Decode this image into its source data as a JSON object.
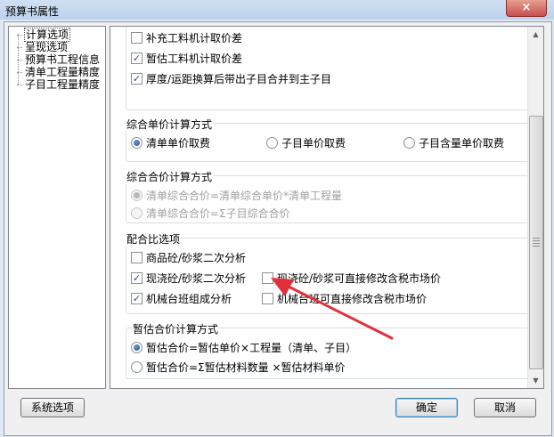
{
  "window": {
    "title": "预算书属性",
    "close_icon": "×"
  },
  "tree": {
    "items": [
      {
        "label": "计算选项",
        "selected": true
      },
      {
        "label": "呈现选项",
        "selected": false
      },
      {
        "label": "预算书工程信息",
        "selected": false
      },
      {
        "label": "清单工程量精度",
        "selected": false
      },
      {
        "label": "子目工程量精度",
        "selected": false
      }
    ]
  },
  "top_options": [
    {
      "label": "补充工料机计取价差",
      "checked": false
    },
    {
      "label": "暂估工料机计取价差",
      "checked": true
    },
    {
      "label": "厚度/运距换算后带出子目合并到主子目",
      "checked": true
    }
  ],
  "unit_price_group": {
    "title": "综合单价计算方式",
    "options": [
      {
        "label": "清单单价取费",
        "checked": true
      },
      {
        "label": "子目单价取费",
        "checked": false
      },
      {
        "label": "子目含量单价取费",
        "checked": false
      }
    ]
  },
  "total_price_group": {
    "title": "综合合价计算方式",
    "options": [
      {
        "label": "清单综合合价=清单综合单价*清单工程量",
        "checked": true
      },
      {
        "label": "清单综合合价=Σ子目综合合价",
        "checked": false
      }
    ]
  },
  "mix_group": {
    "title": "配合比选项",
    "options": [
      {
        "label": "商品砼/砂浆二次分析",
        "checked": false
      },
      {
        "label": "现浇砼/砂浆二次分析",
        "checked": true
      },
      {
        "label": "现浇砼/砂浆可直接修改含税市场价",
        "checked": false
      },
      {
        "label": "机械台班组成分析",
        "checked": true
      },
      {
        "label": "机械台班可直接修改含税市场价",
        "checked": false
      }
    ]
  },
  "estimate_group": {
    "title": "暂估合价计算方式",
    "options": [
      {
        "label": "暂估合价=暂估单价×工程量（清单、子目）",
        "checked": true
      },
      {
        "label": "暂估合价=Σ暂估材料数量  ×暂估材料单价",
        "checked": false
      }
    ]
  },
  "buttons": {
    "system_options": "系统选项",
    "ok": "确定",
    "cancel": "取消"
  },
  "colors": {
    "annotation_arrow": "#e0313b"
  }
}
